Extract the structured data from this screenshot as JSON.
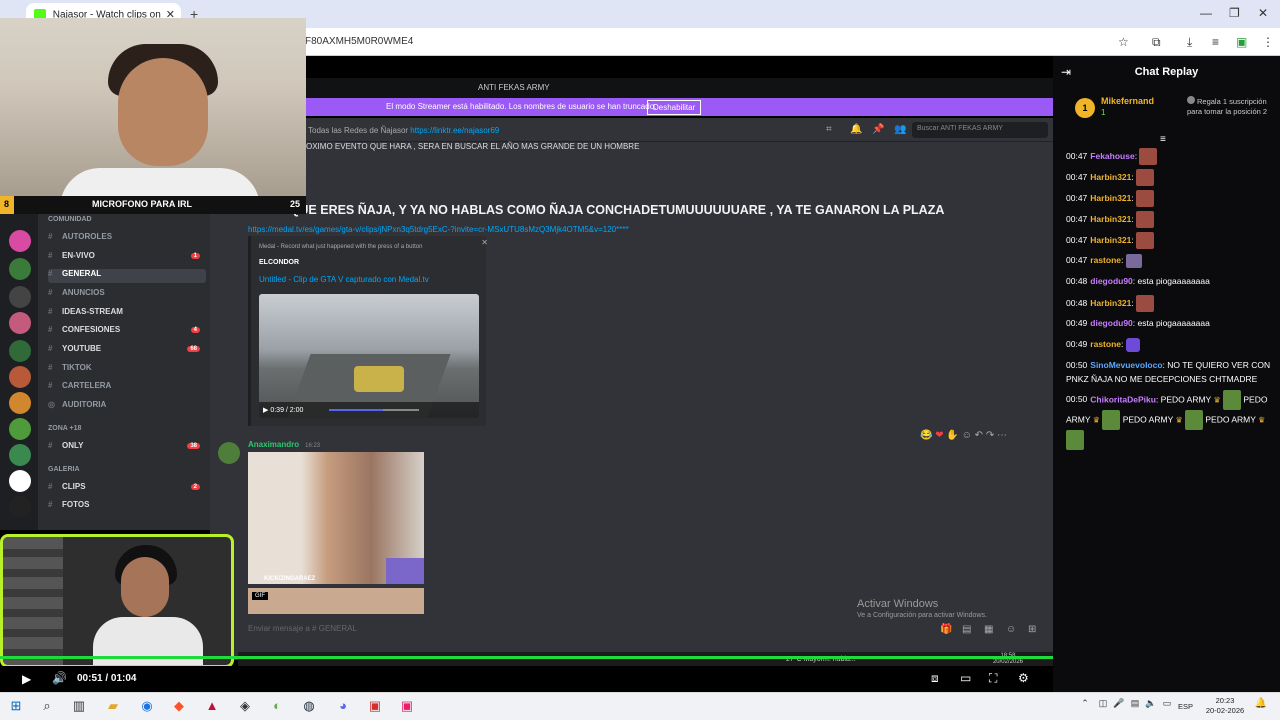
{
  "browser": {
    "tab_title": "Najasor - Watch clips on Kick",
    "new_tab": "+",
    "url": "F80AXMH5M0R0WME4",
    "controls": {
      "minimize": "—",
      "maximize": "❐",
      "close": "✕"
    }
  },
  "discord": {
    "window_title": "ANTI FEKAS ARMY",
    "streamer_banner": "El modo Streamer está habilitado. Los nombres de usuario se han truncado.",
    "streamer_button": "Deshabilitar",
    "channel_topic": "Todas las Redes de Ñajasor",
    "channel_link": "https://linktr.ee/najasor69",
    "search_placeholder": "Buscar ANTI FEKAS ARMY",
    "categories": {
      "comunidad": "COMUNIDAD",
      "zona": "ZONA +18",
      "galeria": "GALERIA"
    },
    "channels": [
      {
        "label": "AUTOROLES",
        "badge": ""
      },
      {
        "label": "EN-VIVO",
        "badge": "1"
      },
      {
        "label": "GENERAL",
        "badge": ""
      },
      {
        "label": "ANUNCIOS",
        "badge": ""
      },
      {
        "label": "IDEAS-STREAM",
        "badge": ""
      },
      {
        "label": "CONFESIONES",
        "badge": "4"
      },
      {
        "label": "YOUTUBE",
        "badge": "68"
      },
      {
        "label": "TIKTOK",
        "badge": ""
      },
      {
        "label": "CARTELERA",
        "badge": ""
      },
      {
        "label": "AUDITORIA",
        "badge": ""
      },
      {
        "label": "ONLY",
        "badge": "38"
      },
      {
        "label": "CLIPS",
        "badge": "2"
      },
      {
        "label": "FOTOS",
        "badge": ""
      }
    ],
    "message_top": "OXIMO EVENTO QUE HARA , SERA EN BUSCAR EL AÑO MAS GRANDE DE UN HOMBRE",
    "message_big": "DICES QUE ERES ÑAJA, Y YA NO HABLAS COMO ÑAJA CONCHADETUMUUUUUUARE , YA TE GANARON LA PLAZA",
    "medal_link": "https://medal.tv/es/games/gta-v/clips/jNPxn3q5tdrg5ExC-?invite=cr-MSxUTU8sMzQ3Mjk4OTM5&v=120****",
    "embed": {
      "provider": "Medal - Record what just happened with the press of a button",
      "author": "ELCONDOR",
      "title": "Untitled - Clip de GTA V capturado con Medal.tv",
      "time": "0:39 / 2:00"
    },
    "author2": "Anaximandro",
    "author2_time": "16:23",
    "img_tag": "KICK/ZINGARAEZ",
    "gif_label": "GIF",
    "composer": "Enviar mensaje a #",
    "composer_channel": "GENERAL",
    "activate_title": "Activar Windows",
    "activate_sub": "Ve a Configuración para activar Windows."
  },
  "overlay": {
    "mic_label": "MICROFONO PARA IRL",
    "accent_number": "8",
    "right_number": "25"
  },
  "inner_taskbar": {
    "weather": "27°C  Mayorm. nubla...",
    "time": "18:58",
    "date": "20/02/2026"
  },
  "player": {
    "time": "00:51 / 01:04"
  },
  "chat": {
    "title": "Chat Replay",
    "pinned": {
      "rank": "1",
      "name": "Mikefernand",
      "count": "1",
      "gift_text": "Regala 1 suscripción para tomar la posición 2"
    },
    "messages": [
      {
        "ts": "00:47",
        "user": "Fekahouse",
        "color": "#c77dff",
        "text": "",
        "emote": "red"
      },
      {
        "ts": "00:47",
        "user": "Harbin321",
        "color": "#f0b429",
        "text": "",
        "emote": "red"
      },
      {
        "ts": "00:47",
        "user": "Harbin321",
        "color": "#f0b429",
        "text": "",
        "emote": "red"
      },
      {
        "ts": "00:47",
        "user": "Harbin321",
        "color": "#f0b429",
        "text": "",
        "emote": "red"
      },
      {
        "ts": "00:47",
        "user": "Harbin321",
        "color": "#f0b429",
        "text": "",
        "emote": "red"
      },
      {
        "ts": "00:47",
        "user": "rastone",
        "color": "#f0b429",
        "text": "",
        "emote": "face"
      },
      {
        "ts": "00:48",
        "user": "diegodu90",
        "color": "#c77dff",
        "text": "esta piogaaaaaaaa",
        "emote": ""
      },
      {
        "ts": "00:48",
        "user": "Harbin321",
        "color": "#f0b429",
        "text": "",
        "emote": "red"
      },
      {
        "ts": "00:49",
        "user": "diegodu90",
        "color": "#c77dff",
        "text": "esta piogaaaaaaaa",
        "emote": ""
      },
      {
        "ts": "00:49",
        "user": "rastone",
        "color": "#f0b429",
        "text": "",
        "emote": "purple"
      },
      {
        "ts": "00:50",
        "user": "SinoMevuevoloco",
        "color": "#5aa9ff",
        "text": "NO TE QUIERO VER CON PNKZ ÑAJA NO ME DECEPCIONES CHTMADRE",
        "emote": ""
      }
    ],
    "last": {
      "ts": "00:50",
      "user": "ChikoritaDePiku",
      "color": "#c77dff",
      "parts": [
        "PEDO ARMY",
        "PEDO ARMY",
        "PEDO ARMY",
        "PEDO ARMY"
      ]
    }
  },
  "taskbar": {
    "lang": "ESP",
    "time": "20:23",
    "date": "20-02-2026"
  },
  "colors": {
    "kick_green": "#53fc18",
    "discord_blurple": "#9b59f5",
    "gold": "#f0b429"
  }
}
